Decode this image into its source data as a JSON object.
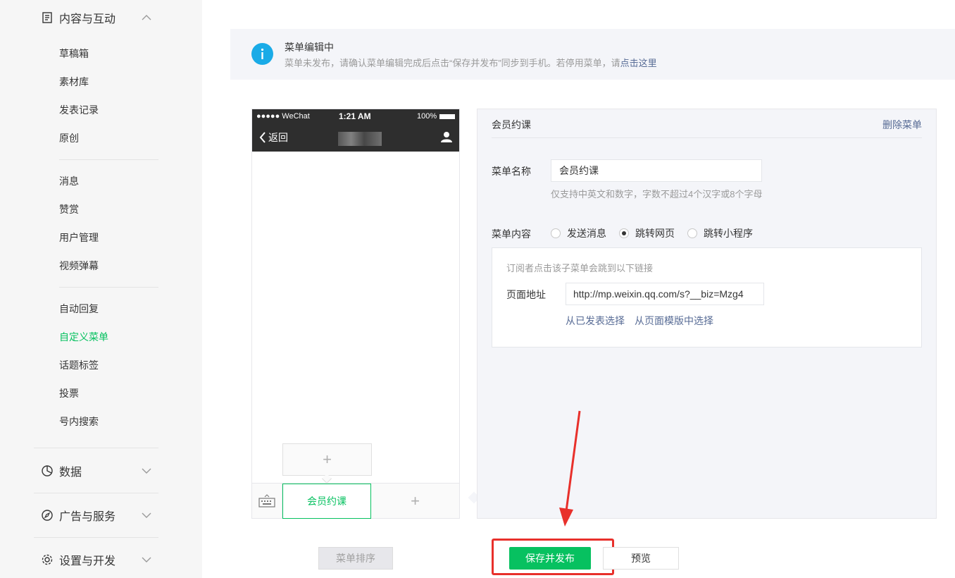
{
  "sidebar": {
    "group_content": "内容与互动",
    "items_a": [
      "草稿箱",
      "素材库",
      "发表记录",
      "原创"
    ],
    "items_b": [
      "消息",
      "赞赏",
      "用户管理",
      "视频弹幕"
    ],
    "items_c": [
      "自动回复",
      "自定义菜单",
      "话题标签",
      "投票",
      "号内搜索"
    ],
    "active_item": "自定义菜单",
    "group_data": "数据",
    "group_ads": "广告与服务",
    "group_settings": "设置与开发"
  },
  "notice": {
    "title": "菜单编辑中",
    "desc_prefix": "菜单未发布，请确认菜单编辑完成后点击“保存并发布”同步到手机。若停用菜单，请",
    "desc_link": "点击这里"
  },
  "phone": {
    "carrier": "●●●●● WeChat",
    "time": "1:21 AM",
    "battery": "100%",
    "back_label": "返回",
    "sub_add": "+",
    "menu_item": "会员约课",
    "menu_add": "+"
  },
  "editor": {
    "header": "会员约课",
    "delete_label": "删除菜单",
    "name_label": "菜单名称",
    "name_value": "会员约课",
    "name_tip": "仅支持中英文和数字，字数不超过4个汉字或8个字母",
    "content_label": "菜单内容",
    "options": [
      "发送消息",
      "跳转网页",
      "跳转小程序"
    ],
    "selected_option": "跳转网页",
    "link_desc": "订阅者点击该子菜单会跳到以下链接",
    "url_label": "页面地址",
    "url_value": "http://mp.weixin.qq.com/s?__biz=Mzg4",
    "link_published": "从已发表选择",
    "link_template": "从页面模版中选择"
  },
  "buttons": {
    "sort": "菜单排序",
    "save": "保存并发布",
    "preview": "预览"
  },
  "colors": {
    "accent": "#07c160",
    "link": "#576b95",
    "annotation": "#e8302b"
  }
}
